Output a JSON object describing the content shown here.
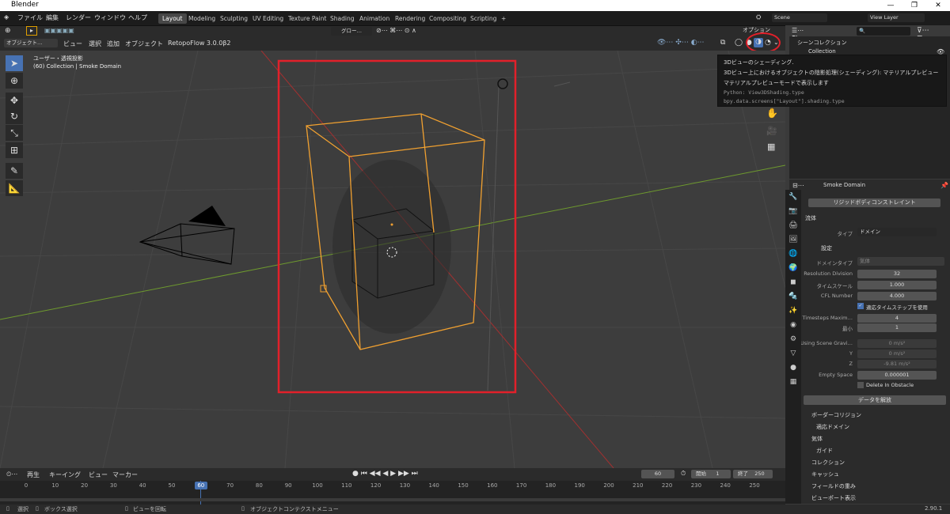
{
  "window": {
    "title": "Blender",
    "min": "—",
    "max": "❐",
    "close": "✕"
  },
  "menu": [
    "ファイル",
    "編集",
    "レンダー",
    "ウィンドウ",
    "ヘルプ"
  ],
  "workspaces": [
    "Layout",
    "Modeling",
    "Sculpting",
    "UV Editing",
    "Texture Paint",
    "Shading",
    "Animation",
    "Rendering",
    "Compositing",
    "Scripting",
    "+"
  ],
  "scene": {
    "scene_name": "Scene",
    "view_layer": "View Layer"
  },
  "viewport_header": {
    "mode": "オブジェクト…",
    "menus": [
      "ビュー",
      "選択",
      "追加",
      "オブジェクト"
    ],
    "addon": "RetopoFlow 3.0.0β2",
    "orient": "グロー…",
    "options": "オプション"
  },
  "viewport": {
    "line1": "ユーザー・透視投影",
    "line2": "(60) Collection | Smoke Domain"
  },
  "tooltip": {
    "title": "3Dビューのシェーディング.",
    "desc": "3Dビュー上におけるオブジェクトの陰影処理(シェーディング):",
    "value": "マテリアルプレビュー",
    "desc2": "マテリアルプレビューモードで表示します",
    "py1": "Python: View3DShading.type",
    "py2": "bpy.data.screens[\"Layout\"].shading.type"
  },
  "outliner": {
    "title": "シーンコレクション",
    "item": "Collection"
  },
  "props": {
    "object": "Smoke Domain",
    "rigid": "リジッドボディコンストレイント",
    "fluid": "流体",
    "type_label": "タイプ",
    "type_value": "ドメイン",
    "settings": "設定",
    "domain_type_label": "ドメインタイプ",
    "domain_type_value": "気体",
    "res_label": "Resolution Division",
    "res_value": "32",
    "time_label": "タイムスケール",
    "time_value": "1.000",
    "cfl_label": "CFL Number",
    "cfl_value": "4.000",
    "adaptive": "適応タイムステップを使用",
    "ts_label": "Timesteps Maxim…",
    "ts_value": "4",
    "min_label": "最小",
    "min_value": "1",
    "grav_label": "Using Scene Gravi…",
    "gx": "0 m/s²",
    "y_label": "Y",
    "gy": "0 m/s²",
    "z_label": "Z",
    "gz": "-9.81 m/s²",
    "empty_label": "Empty Space",
    "empty_value": "0.000001",
    "delete_obstacle": "Delete In Obstacle",
    "free_data": "データを解放",
    "panels": [
      "ボーダーコリジョン",
      "適応ドメイン",
      "気体",
      "ガイド",
      "コレクション",
      "キャッシュ",
      "フィールドの重み",
      "ビューポート表示"
    ]
  },
  "timeline": {
    "menus": [
      "再生",
      "キーイング",
      "ビュー",
      "マーカー"
    ],
    "current": "60",
    "start_label": "開始",
    "start": "1",
    "end_label": "終了",
    "end": "250",
    "ticks": [
      "0",
      "10",
      "20",
      "30",
      "40",
      "50",
      "60",
      "70",
      "80",
      "90",
      "100",
      "110",
      "120",
      "130",
      "140",
      "150",
      "160",
      "170",
      "180",
      "190",
      "200",
      "210",
      "220",
      "230",
      "240",
      "250"
    ]
  },
  "status": {
    "select": "選択",
    "box": "ボックス選択",
    "rotate": "ビューを回転",
    "context": "オブジェクトコンテクストメニュー",
    "version": "2.90.1"
  }
}
